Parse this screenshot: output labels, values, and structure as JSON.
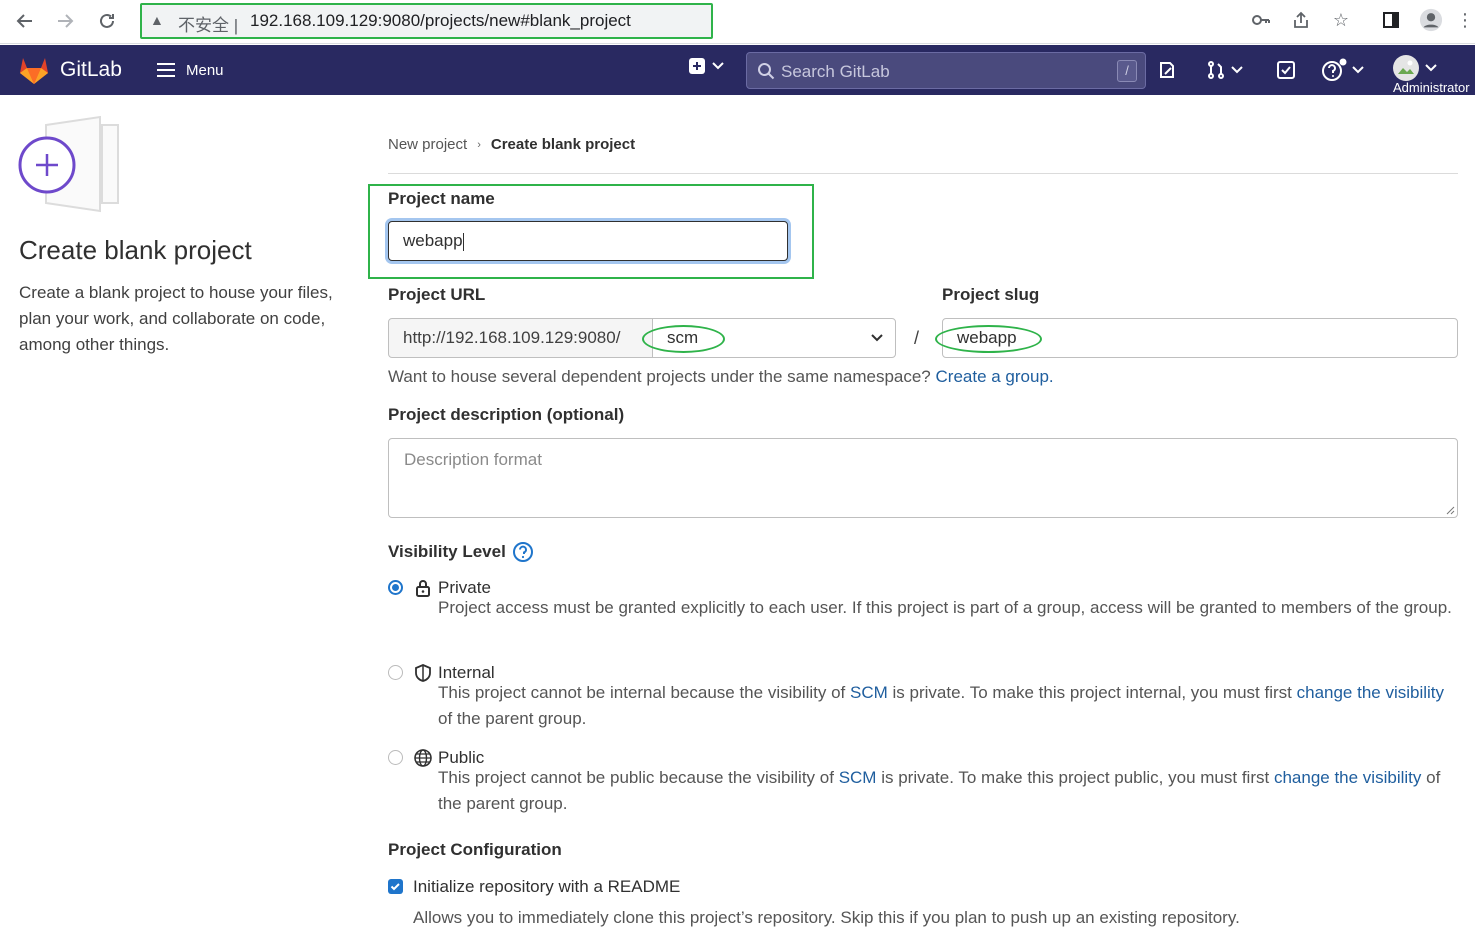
{
  "browser": {
    "insecure_label": "不安全 |",
    "url": "192.168.109.129:9080/projects/new#blank_project"
  },
  "topnav": {
    "brand": "GitLab",
    "menu_label": "Menu",
    "search_placeholder": "Search GitLab",
    "search_shortcut": "/",
    "user_label": "Administrator"
  },
  "left": {
    "title": "Create blank project",
    "description": "Create a blank project to house your files, plan your work, and collaborate on code, among other things."
  },
  "breadcrumb": {
    "parent": "New project",
    "current": "Create blank project"
  },
  "form": {
    "project_name_label": "Project name",
    "project_name_value": "webapp",
    "project_url_label": "Project URL",
    "project_url_prefix": "http://192.168.109.129:9080/",
    "namespace_value": "scm",
    "slug_separator": "/",
    "project_slug_label": "Project slug",
    "project_slug_value": "webapp",
    "namespace_help_text": "Want to house several dependent projects under the same namespace?",
    "namespace_help_link": "Create a group.",
    "description_label": "Project description (optional)",
    "description_placeholder": "Description format"
  },
  "visibility": {
    "title": "Visibility Level",
    "options": [
      {
        "label": "Private",
        "selected": true,
        "desc": "Project access must be granted explicitly to each user. If this project is part of a group, access will be granted to members of the group."
      },
      {
        "label": "Internal",
        "selected": false,
        "desc_before": "This project cannot be internal because the visibility of",
        "desc_link1": "SCM",
        "desc_middle": "is private. To make this project internal, you must first",
        "desc_link2": "change the visibility",
        "desc_after": "of the parent group."
      },
      {
        "label": "Public",
        "selected": false,
        "desc_before": "This project cannot be public because the visibility of",
        "desc_link1": "SCM",
        "desc_middle": "is private. To make this project public, you must first",
        "desc_link2": "change the visibility",
        "desc_after": "of the parent group."
      }
    ]
  },
  "config": {
    "title": "Project Configuration",
    "readme_label": "Initialize repository with a README",
    "readme_checked": true,
    "readme_help": "Allows you to immediately clone this project’s repository. Skip this if you plan to push up an existing repository."
  },
  "colors": {
    "nav_bg": "#292961",
    "accent": "#1f75cb",
    "highlight": "#2fb34a",
    "link": "#1f5e9e"
  }
}
